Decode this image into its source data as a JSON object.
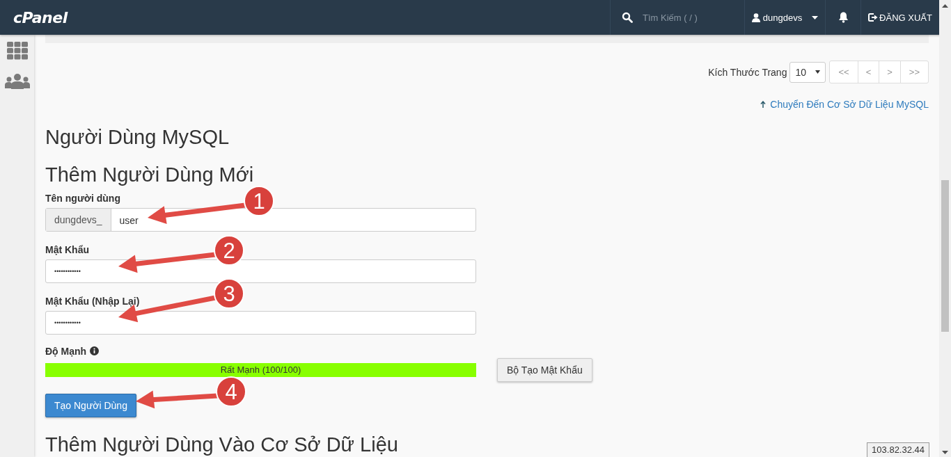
{
  "topbar": {
    "logo": "cPanel",
    "search": {
      "placeholder": "Tìm Kiếm ( / )"
    },
    "user": "dungdevs",
    "logout": "ĐĂNG XUẤT"
  },
  "sidebar": {
    "items": [
      {
        "kind": "apps"
      },
      {
        "kind": "users"
      }
    ]
  },
  "pagination": {
    "label": "Kích Thước Trang",
    "page_size": "10",
    "buttons": [
      "<<",
      "<",
      ">",
      ">>"
    ]
  },
  "jump_link": "Chuyển Đến Cơ Sở Dữ Liệu MySQL",
  "section_title": "Người Dùng MySQL",
  "form": {
    "title": "Thêm Người Dùng Mới",
    "username": {
      "label": "Tên người dùng",
      "prefix": "dungdevs_",
      "value": "user"
    },
    "password": {
      "label": "Mật Khẩu",
      "value": "••••••••••••"
    },
    "password_repeat": {
      "label": "Mật Khẩu (Nhập Lại)",
      "value": "••••••••••••"
    },
    "strength": {
      "label": "Độ Mạnh",
      "level": 1,
      "reading": "Rất Mạnh (100/100)"
    },
    "generator_button": "Bộ Tạo Mật Khẩu",
    "submit_button": "Tạo Người Dùng"
  },
  "next_section_title": "Thêm Người Dùng Vào Cơ Sở Dữ Liệu",
  "annotations": [
    {
      "number": "1"
    },
    {
      "number": "2"
    },
    {
      "number": "3"
    },
    {
      "number": "4"
    }
  ],
  "ip_badge": "103.82.32.44"
}
